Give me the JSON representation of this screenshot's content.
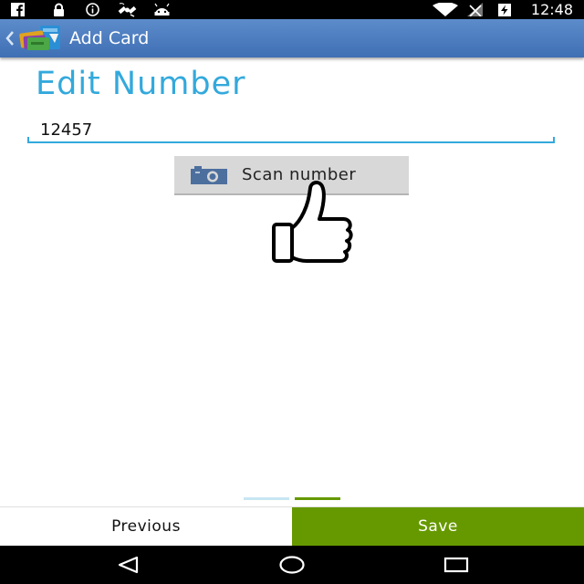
{
  "status_bar": {
    "time": "12:48",
    "left_icons": [
      "facebook-icon",
      "lock-icon",
      "info-icon",
      "satellite-icon",
      "android-icon"
    ],
    "right_icons": [
      "wifi-icon",
      "signal-icon",
      "battery-charging-icon"
    ]
  },
  "action_bar": {
    "title": "Add Card",
    "color": "#4a7cc0"
  },
  "main": {
    "title": "Edit Number",
    "number_value": "12457",
    "scan_button_label": "Scan number",
    "accent_color": "#33a9dc"
  },
  "pager": {
    "page_count": 2,
    "current_page": 2
  },
  "bottom_bar": {
    "previous_label": "Previous",
    "save_label": "Save",
    "save_color": "#669900"
  },
  "nav_bar": {
    "buttons": [
      "back-icon",
      "home-icon",
      "recents-icon"
    ]
  }
}
